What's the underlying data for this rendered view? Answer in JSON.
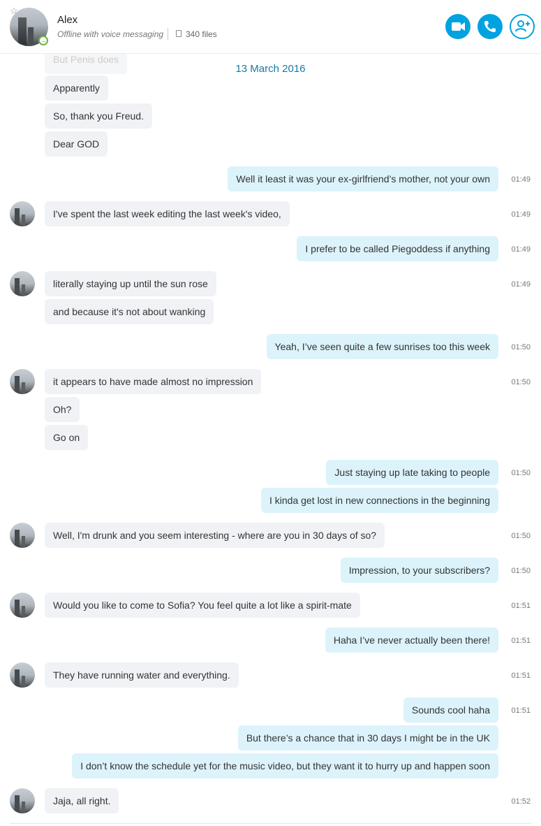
{
  "header": {
    "name": "Alex",
    "status": "Offline with voice messaging",
    "files": "340 files"
  },
  "date_label": "13 March 2016",
  "partial_message": "But Penis does",
  "messages": [
    {
      "dir": "in",
      "avatar": false,
      "text": "Apparently",
      "time": ""
    },
    {
      "dir": "in",
      "avatar": false,
      "text": "So, thank you Freud.",
      "time": ""
    },
    {
      "dir": "in",
      "avatar": false,
      "text": "Dear GOD",
      "time": ""
    },
    {
      "dir": "out",
      "avatar": false,
      "text": "Well it least it was your ex-girlfriend’s mother, not your own",
      "time": "01:49"
    },
    {
      "dir": "in",
      "avatar": true,
      "text": "I've spent the last week editing the last week's video,",
      "time": "01:49"
    },
    {
      "dir": "out",
      "avatar": false,
      "text": "I prefer to be called Piegoddess if anything",
      "time": "01:49"
    },
    {
      "dir": "in",
      "avatar": true,
      "text": "literally staying up until the sun rose",
      "time": "01:49"
    },
    {
      "dir": "in",
      "avatar": false,
      "text": "and because it's not about wanking",
      "time": ""
    },
    {
      "dir": "out",
      "avatar": false,
      "text": "Yeah, I’ve seen quite a few sunrises too this week",
      "time": "01:50"
    },
    {
      "dir": "in",
      "avatar": true,
      "text": "it appears to have made almost no impression",
      "time": "01:50"
    },
    {
      "dir": "in",
      "avatar": false,
      "text": "Oh?",
      "time": ""
    },
    {
      "dir": "in",
      "avatar": false,
      "text": "Go on",
      "time": ""
    },
    {
      "dir": "out",
      "avatar": false,
      "text": "Just staying up late taking to people",
      "time": "01:50"
    },
    {
      "dir": "out",
      "avatar": false,
      "text": "I kinda get lost in new connections in the beginning",
      "time": ""
    },
    {
      "dir": "in",
      "avatar": true,
      "text": "Well, I'm drunk and you seem interesting - where are you in 30 days of so?",
      "time": "01:50"
    },
    {
      "dir": "out",
      "avatar": false,
      "text": "Impression, to your subscribers?",
      "time": "01:50"
    },
    {
      "dir": "in",
      "avatar": true,
      "text": "Would you like to come to Sofia? You feel quite a lot like a spirit-mate",
      "time": "01:51"
    },
    {
      "dir": "out",
      "avatar": false,
      "text": "Haha I’ve never actually been there!",
      "time": "01:51"
    },
    {
      "dir": "in",
      "avatar": true,
      "text": "They have running water and everything.",
      "time": "01:51"
    },
    {
      "dir": "out",
      "avatar": false,
      "text": "Sounds cool haha",
      "time": "01:51"
    },
    {
      "dir": "out",
      "avatar": false,
      "text": "But there’s a chance that in 30 days I might be in the UK",
      "time": ""
    },
    {
      "dir": "out",
      "avatar": false,
      "text": "I don’t know the schedule yet for the music video, but they want it to hurry up and happen soon",
      "time": ""
    },
    {
      "dir": "in",
      "avatar": true,
      "text": "Jaja, all right.",
      "time": "01:52"
    }
  ]
}
